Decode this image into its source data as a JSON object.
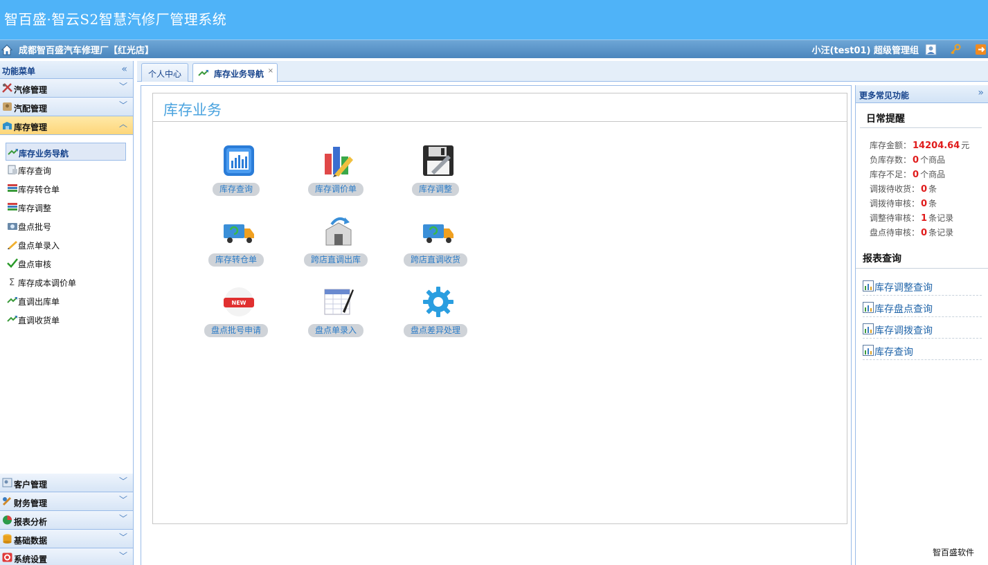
{
  "app": {
    "title": "智百盛·智云S2智慧汽修厂管理系统",
    "shop": "成都智百盛汽车修理厂【红光店】",
    "user": "小汪(test01) 超级管理组",
    "brand": "智百盛软件"
  },
  "sidebar": {
    "header": "功能菜单",
    "collapse_icon": "«",
    "groups_top": [
      {
        "label": "汽修管理",
        "icon": "tools-icon",
        "color": "#c04040"
      },
      {
        "label": "汽配管理",
        "icon": "parts-icon",
        "color": "#c9a46a"
      },
      {
        "label": "库存管理",
        "icon": "inventory-icon",
        "color": "#2f8fc9"
      }
    ],
    "items": [
      {
        "label": "库存业务导航",
        "icon": "nav-arrows-icon"
      },
      {
        "label": "库存查询",
        "icon": "document-icon"
      },
      {
        "label": "库存转仓单",
        "icon": "list-icon"
      },
      {
        "label": "库存调整",
        "icon": "list-icon"
      },
      {
        "label": "盘点批号",
        "icon": "camera-icon"
      },
      {
        "label": "盘点单录入",
        "icon": "pencil-icon"
      },
      {
        "label": "盘点审核",
        "icon": "checkmark-icon"
      },
      {
        "label": "库存成本调价单",
        "icon": "sigma-icon"
      },
      {
        "label": "直调出库单",
        "icon": "nav-arrows-icon"
      },
      {
        "label": "直调收货单",
        "icon": "nav-arrows-icon"
      }
    ],
    "groups_bottom": [
      {
        "label": "客户管理",
        "icon": "customer-icon",
        "color": "#6f8fb3"
      },
      {
        "label": "财务管理",
        "icon": "finance-icon",
        "color": "#d08a2a"
      },
      {
        "label": "报表分析",
        "icon": "pie-chart-icon",
        "color": "#e04040"
      },
      {
        "label": "基础数据",
        "icon": "database-icon",
        "color": "#e8a020"
      },
      {
        "label": "系统设置",
        "icon": "settings-icon",
        "color": "#e03a3a"
      }
    ]
  },
  "tabs": [
    {
      "label": "个人中心"
    },
    {
      "label": "库存业务导航",
      "close": "×"
    }
  ],
  "main": {
    "panel_title": "库存业务",
    "tiles": [
      {
        "label": "库存查询",
        "icon": "bar-chart-icon"
      },
      {
        "label": "库存调价单",
        "icon": "price-edit-icon"
      },
      {
        "label": "库存调整",
        "icon": "floppy-edit-icon"
      },
      {
        "label": "库存转仓单",
        "icon": "truck-icon"
      },
      {
        "label": "跨店直调出库",
        "icon": "transfer-out-icon"
      },
      {
        "label": "跨店直调收货",
        "icon": "truck-receive-icon"
      },
      {
        "label": "盘点批号申请",
        "icon": "new-badge-icon"
      },
      {
        "label": "盘点单录入",
        "icon": "sheet-pen-icon"
      },
      {
        "label": "盘点差异处理",
        "icon": "gear-icon"
      }
    ]
  },
  "right": {
    "header": "更多常见功能",
    "expand_icon": "»",
    "reminder_title": "日常提醒",
    "stats": [
      {
        "label": "库存金额：",
        "value": "14204.64",
        "unit": "元"
      },
      {
        "label": "负库存数：",
        "value": "0",
        "unit": "个商品"
      },
      {
        "label": "库存不足：",
        "value": "0",
        "unit": "个商品"
      },
      {
        "label": "调拨待收货：",
        "value": "0",
        "unit": "条"
      },
      {
        "label": "调拨待审核：",
        "value": "0",
        "unit": "条"
      },
      {
        "label": "调整待审核：",
        "value": "1",
        "unit": "条记录"
      },
      {
        "label": "盘点待审核：",
        "value": "0",
        "unit": "条记录"
      }
    ],
    "report_title": "报表查询",
    "links": [
      {
        "label": "库存调整查询"
      },
      {
        "label": "库存盘点查询"
      },
      {
        "label": "库存调拨查询"
      },
      {
        "label": "库存查询"
      }
    ]
  }
}
